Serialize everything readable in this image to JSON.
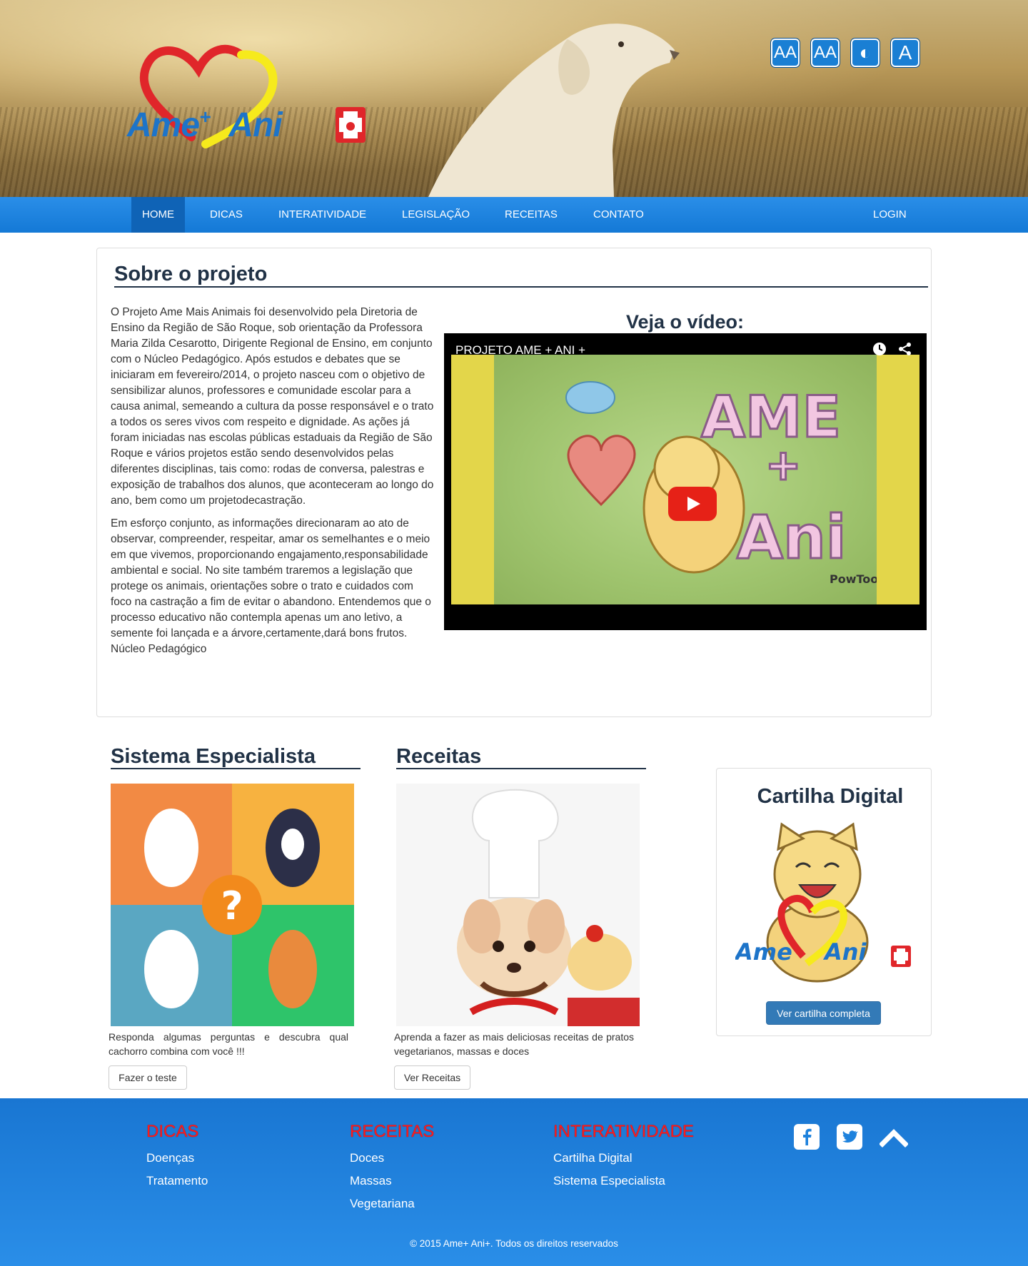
{
  "brand": {
    "logo_part1": "Ame",
    "logo_plus": "+",
    "logo_part2": "Ani"
  },
  "accessibility": [
    {
      "label": "AA",
      "icon": "font-increase-icon"
    },
    {
      "label": "AA",
      "icon": "font-decrease-icon"
    },
    {
      "label": "◐",
      "icon": "contrast-icon"
    },
    {
      "label": "A",
      "icon": "font-reset-icon"
    }
  ],
  "nav": {
    "items": [
      "HOME",
      "DICAS",
      "INTERATIVIDADE",
      "LEGISLAÇÃO",
      "RECEITAS",
      "CONTATO"
    ],
    "login": "LOGIN"
  },
  "about": {
    "title": "Sobre o projeto",
    "paragraph1": "O Projeto Ame Mais Animais foi desenvolvido pela Diretoria de Ensino da Região de São Roque, sob orientação da Professora Maria Zilda Cesarotto, Dirigente Regional de Ensino, em conjunto com o Núcleo Pedagógico. Após estudos e debates que se iniciaram em fevereiro/2014, o projeto nasceu com o objetivo de sensibilizar alunos, professores e comunidade escolar para a causa animal, semeando a cultura da posse responsável e o trato a todos os seres vivos com respeito e dignidade. As ações já foram iniciadas nas escolas públicas estaduais da Região de São Roque e vários projetos estão sendo desenvolvidos pelas diferentes disciplinas, tais como: rodas de conversa, palestras e exposição de trabalhos dos alunos, que aconteceram ao longo do ano, bem como um projetodecastração.",
    "paragraph2": "Em esforço conjunto, as informações direcionaram ao ato de observar, compreender, respeitar, amar os semelhantes e o meio em que vivemos, proporcionando engajamento,responsabilidade ambiental e social. No site também traremos a legislação que protege os animais, orientações sobre o trato e cuidados com foco na castração a fim de evitar o abandono. Entendemos que o processo educativo não contempla apenas um ano letivo, a semente foi lançada e a árvore,certamente,dará bons frutos.",
    "signature": "Núcleo Pedagógico"
  },
  "video": {
    "heading": "Veja o vídeo:",
    "title": "PROJETO AME + ANI +",
    "art_text1": "AME",
    "art_text2": "+",
    "art_text3": "Ani",
    "credit": "PowToon"
  },
  "sistema": {
    "title": "Sistema Especialista",
    "description": "Responda algumas perguntas e descubra qual cachorro combina com você !!!",
    "button": "Fazer o teste",
    "question_mark": "?"
  },
  "receitas": {
    "title": "Receitas",
    "description": "Aprenda a fazer as mais deliciosas receitas de pratos vegetarianos, massas e doces",
    "button": "Ver Receitas"
  },
  "cartilha": {
    "title": "Cartilha Digital",
    "button": "Ver cartilha completa",
    "logo_part1": "Ame",
    "logo_part2": "Ani"
  },
  "footer": {
    "col1": {
      "title": "DICAS",
      "links": [
        "Doenças",
        "Tratamento"
      ]
    },
    "col2": {
      "title": "RECEITAS",
      "links": [
        "Doces",
        "Massas",
        "Vegetariana"
      ]
    },
    "col3": {
      "title": "INTERATIVIDADE",
      "links": [
        "Cartilha Digital",
        "Sistema Especialista"
      ]
    },
    "copyright": "© 2015 Ame+ Ani+. Todos os direitos reservados"
  },
  "colors": {
    "nav": "#1479d6",
    "title": "#213246",
    "footer_head": "#ff1a1a",
    "primary": "#337ab7"
  }
}
